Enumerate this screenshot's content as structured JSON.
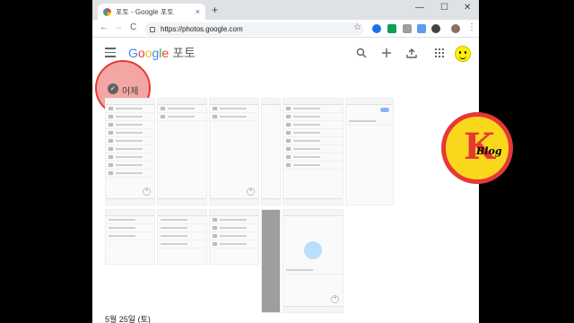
{
  "browser": {
    "tab_title": "포토 - Google 포토",
    "tab_close": "×",
    "new_tab": "+",
    "window_controls": [
      "—",
      "☐",
      "✕"
    ],
    "url": "https://photos.google.com",
    "nav": [
      "←",
      "→",
      "C"
    ],
    "bookmark_star": "☆",
    "menu": "⋮"
  },
  "header": {
    "logo": {
      "G": "G",
      "o1": "o",
      "o2": "o",
      "g": "g",
      "l": "l",
      "e": "e",
      "service": "포토"
    },
    "icons": [
      "search-icon",
      "add-icon",
      "upload-icon",
      "apps-icon",
      "account-icon"
    ]
  },
  "date_group": {
    "check": "✓",
    "label": "어제"
  },
  "footer": {
    "date": "5월 25일 (토)"
  },
  "watermark": {
    "letter": "K",
    "word": "Blog"
  },
  "colors": {
    "accent": "#e53935",
    "badge_bg": "#f9d71c",
    "google_blue": "#4285f4"
  }
}
